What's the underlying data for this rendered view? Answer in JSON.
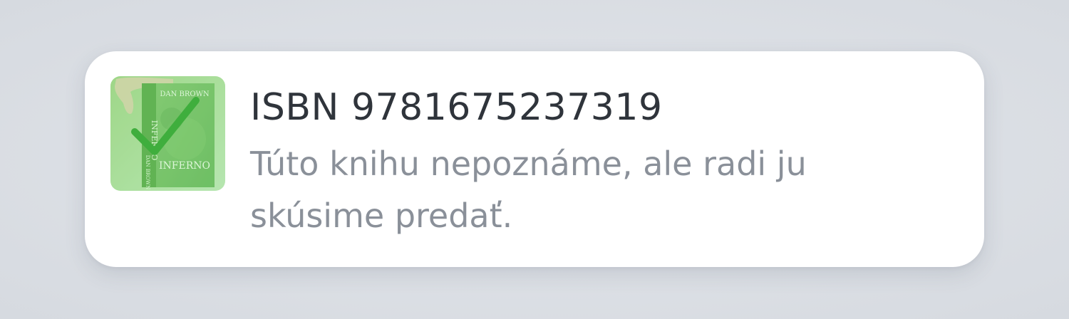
{
  "notification": {
    "title": "ISBN 9781675237319",
    "message": "Túto knihu nepoznáme, ale radi ju skúsime predať.",
    "cover": {
      "author": "DAN BROWN",
      "book_title": "INFERNO",
      "spine_author": "DAN BROWN",
      "spine_title": "INFERNO",
      "status_icon": "checkmark-icon",
      "tint_color": "#6fcf6a"
    }
  },
  "colors": {
    "background": "#d9dde3",
    "card": "#ffffff",
    "title": "#2f343b",
    "message": "#8a9099",
    "check": "#3fae3d"
  }
}
